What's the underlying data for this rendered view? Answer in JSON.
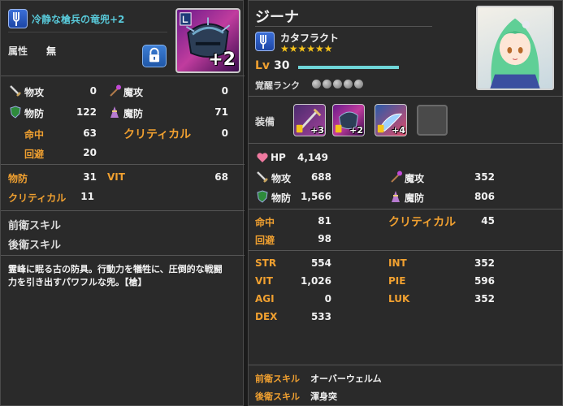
{
  "left": {
    "item_name": "冷静な槍兵の竜兜+2",
    "attr_label": "属性",
    "attr_value": "無",
    "weapon_plus": "+2",
    "stats": {
      "phys_atk_label": "物攻",
      "phys_atk": "0",
      "mag_atk_label": "魔攻",
      "mag_atk": "0",
      "phys_def_label": "物防",
      "phys_def": "122",
      "mag_def_label": "魔防",
      "mag_def": "71",
      "hit_label": "命中",
      "hit": "63",
      "crit_label": "クリティカル",
      "crit": "0",
      "evade_label": "回避",
      "evade": "20"
    },
    "bonus": {
      "phys_def_label": "物防",
      "phys_def": "31",
      "vit_label": "VIT",
      "vit": "68",
      "crit_label": "クリティカル",
      "crit": "11"
    },
    "skills": {
      "front_label": "前衛スキル",
      "back_label": "後衛スキル"
    },
    "description_line1": "霊峰に眠る古の防具。行動力を犠牲に、圧倒的な戦闘",
    "description_line2": "力を引き出すパワフルな兜。【槍】"
  },
  "right": {
    "char_name": "ジーナ",
    "class_name": "カタフラクト",
    "stars": "★★★★★★",
    "level_label": "Lv",
    "level": "30",
    "awaken_label": "覚醒ランク",
    "equip_label": "装備",
    "equip_plus": [
      "+3",
      "+2",
      "+4"
    ],
    "stats": {
      "hp_label": "HP",
      "hp": "4,149",
      "phys_atk_label": "物攻",
      "phys_atk": "688",
      "mag_atk_label": "魔攻",
      "mag_atk": "352",
      "phys_def_label": "物防",
      "phys_def": "1,566",
      "mag_def_label": "魔防",
      "mag_def": "806",
      "hit_label": "命中",
      "hit": "81",
      "crit_label": "クリティカル",
      "crit": "45",
      "evade_label": "回避",
      "evade": "98"
    },
    "attrs": {
      "str_label": "STR",
      "str": "554",
      "int_label": "INT",
      "int": "352",
      "vit_label": "VIT",
      "vit": "1,026",
      "pie_label": "PIE",
      "pie": "596",
      "agi_label": "AGI",
      "agi": "0",
      "luk_label": "LUK",
      "luk": "352",
      "dex_label": "DEX",
      "dex": "533"
    },
    "skills": {
      "front_label": "前衛スキル",
      "front_value": "オーバーウェルム",
      "back_label": "後衛スキル",
      "back_value": "渾身突"
    }
  },
  "colors": {
    "accent_orange": "#f0a030",
    "level_bar": "#6fd6d8",
    "panel_bg": "#2a2a2a"
  },
  "icons": [
    "spear-class-icon",
    "lock-icon",
    "helmet-icon",
    "sword-icon",
    "shield-icon",
    "staff-icon",
    "robe-icon",
    "heart-icon",
    "character-portrait"
  ]
}
